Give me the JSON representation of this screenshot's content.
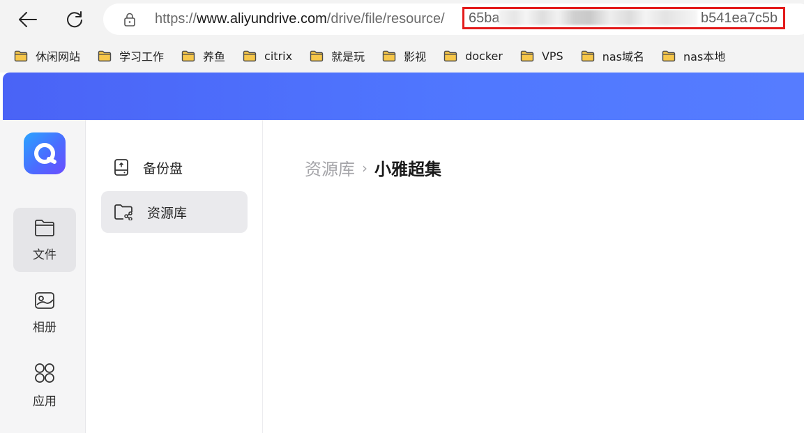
{
  "browser": {
    "url_prefix": "https://",
    "url_host": "www.aliyundrive.com",
    "url_path": "/drive/file/resource/",
    "url_id_start": "65ba3",
    "url_id_end": "b541ea7c5b",
    "highlight_color": "#e31b1b"
  },
  "bookmarks": [
    {
      "label": "休闲网站",
      "icon": "folder-icon"
    },
    {
      "label": "学习工作",
      "icon": "folder-icon"
    },
    {
      "label": "养鱼",
      "icon": "folder-icon"
    },
    {
      "label": "citrix",
      "icon": "folder-icon"
    },
    {
      "label": "就是玩",
      "icon": "folder-icon"
    },
    {
      "label": "影视",
      "icon": "folder-icon"
    },
    {
      "label": "docker",
      "icon": "folder-icon"
    },
    {
      "label": "VPS",
      "icon": "folder-icon"
    },
    {
      "label": "nas域名",
      "icon": "folder-icon"
    },
    {
      "label": "nas本地",
      "icon": "folder-icon"
    }
  ],
  "app": {
    "banner_color": "#4f6ffa",
    "rail": [
      {
        "label": "文件",
        "icon": "folder-icon",
        "active": true
      },
      {
        "label": "相册",
        "icon": "photo-icon",
        "active": false
      },
      {
        "label": "应用",
        "icon": "apps-icon",
        "active": false
      }
    ],
    "sidenav": [
      {
        "label": "备份盘",
        "icon": "backup-drive-icon",
        "active": false
      },
      {
        "label": "资源库",
        "icon": "shared-folder-icon",
        "active": true
      }
    ],
    "breadcrumb": {
      "parent": "资源库",
      "separator": "›",
      "current": "小雅超集"
    }
  }
}
